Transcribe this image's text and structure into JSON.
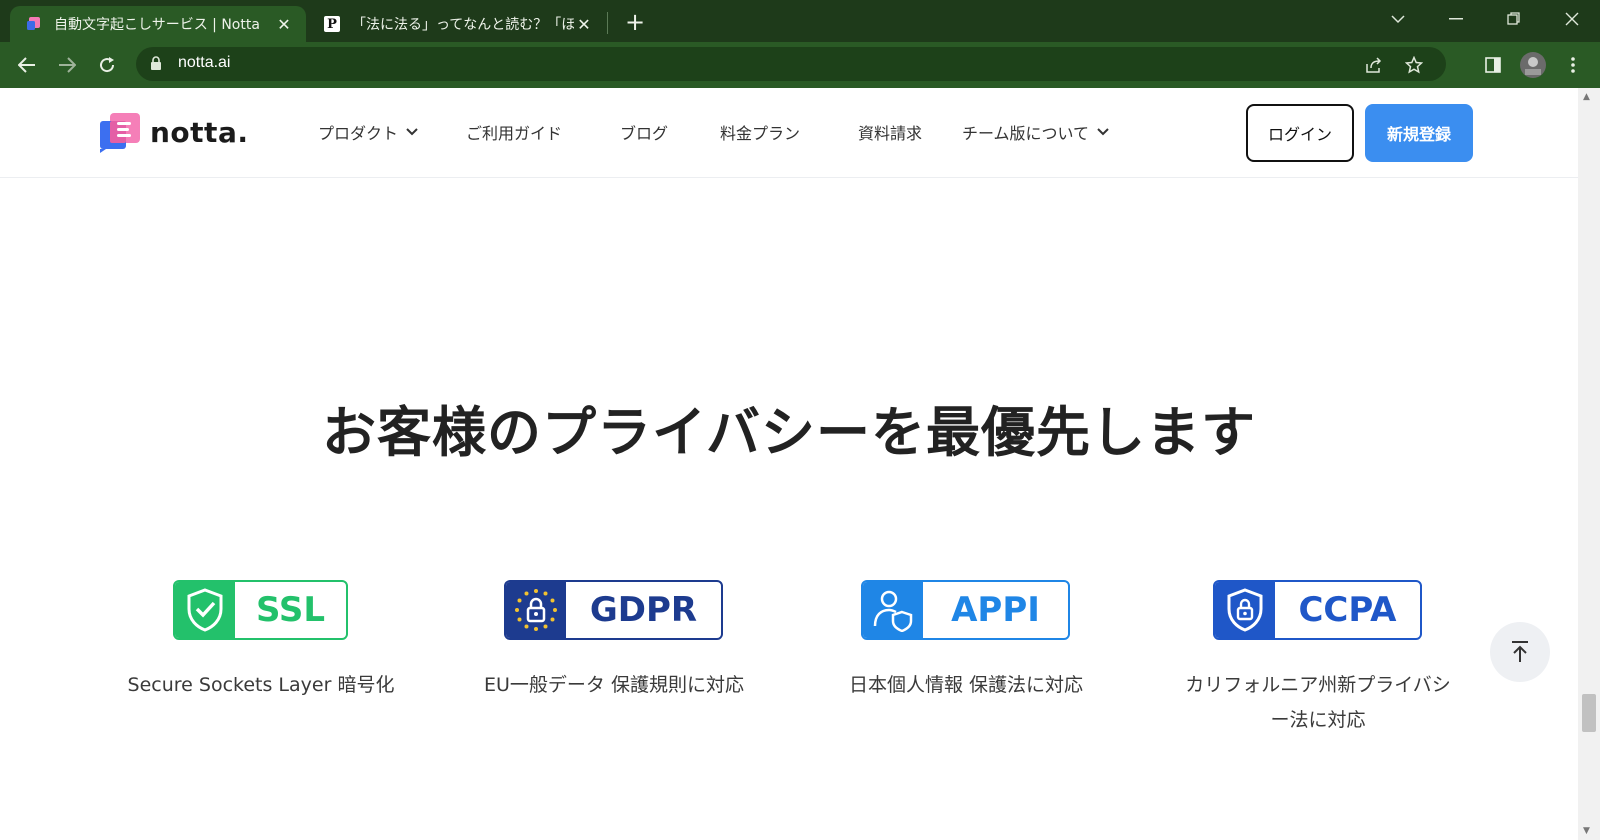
{
  "browser": {
    "tabs": [
      {
        "title": "自動文字起こしサービス | Notta",
        "active": true,
        "favicon": "notta-favicon"
      },
      {
        "title": "「法に法る」ってなんと読む？「ほうにほ",
        "active": false,
        "favicon": "p-favicon",
        "favicon_letter": "P"
      }
    ],
    "address": "notta.ai",
    "accent_colors": {
      "tabbar": "#1e3a1a",
      "toolbar": "#2a5a25"
    }
  },
  "header": {
    "logo_text": "notta.",
    "nav": [
      {
        "label": "プロダクト",
        "has_dropdown": true
      },
      {
        "label": "ご利用ガイド",
        "has_dropdown": false
      },
      {
        "label": "ブログ",
        "has_dropdown": false
      },
      {
        "label": "料金プラン",
        "has_dropdown": false
      },
      {
        "label": "資料請求",
        "has_dropdown": false
      },
      {
        "label": "チーム版について",
        "has_dropdown": true
      }
    ],
    "login_label": "ログイン",
    "signup_label": "新規登録",
    "signup_color": "#3b8ef0"
  },
  "section": {
    "heading": "お客様のプライバシーを最優先します",
    "badges": [
      {
        "label": "SSL",
        "icon": "shield-check-icon",
        "color": "#23c16b",
        "caption": "Secure Sockets Layer 暗号化"
      },
      {
        "label": "GDPR",
        "icon": "eu-lock-icon",
        "color": "#1d3b8f",
        "caption": "EU一般データ 保護規則に対応"
      },
      {
        "label": "APPI",
        "icon": "user-shield-icon",
        "color": "#1f86e6",
        "caption": "日本個人情報 保護法に対応"
      },
      {
        "label": "CCPA",
        "icon": "shield-lock-icon",
        "color": "#1f57c8",
        "caption_lines": [
          "カリフォルニア州新プライバシ",
          "ー法に対応"
        ]
      }
    ]
  }
}
